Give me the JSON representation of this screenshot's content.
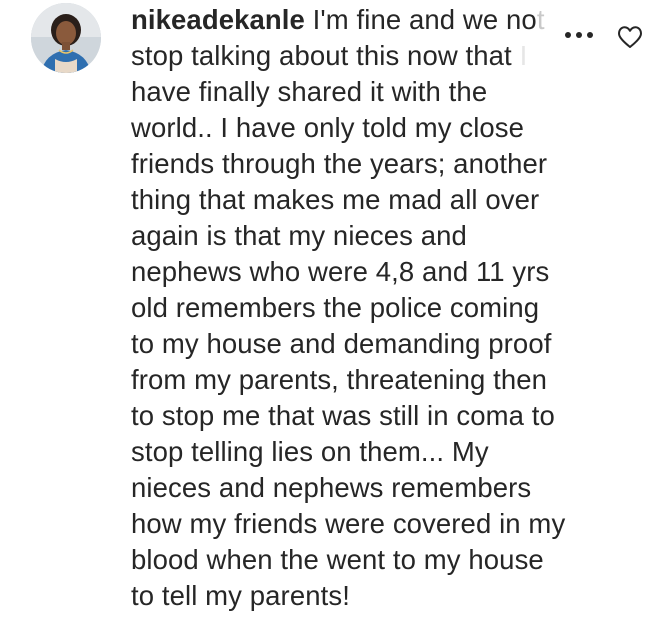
{
  "comment": {
    "username": "nikeadekanle",
    "lines": [
      " I'm fine and we no",
      "stop talking about this now that",
      "have finally shared it with the",
      "world.. I have only told my close",
      "friends through the years; another",
      "thing that makes me mad all over",
      "again is that my nieces and",
      "nephews who were 4,8 and 11 yrs",
      "old remembers the police coming",
      "to my house and demanding proof",
      "from my parents, threatening then",
      "to stop me that was still in coma to",
      "stop telling lies on them... My",
      "nieces and nephews remembers",
      "how my friends were covered in my",
      "blood when the went to my house",
      "to tell my parents!"
    ],
    "faded_tail_1": "t",
    "faded_tail_2": "I"
  },
  "icons": {
    "more": "more-options-icon",
    "like": "heart-outline-icon",
    "avatar": "profile-avatar"
  },
  "colors": {
    "text": "#262626",
    "faded": "#c9c9c9",
    "background": "#ffffff"
  }
}
